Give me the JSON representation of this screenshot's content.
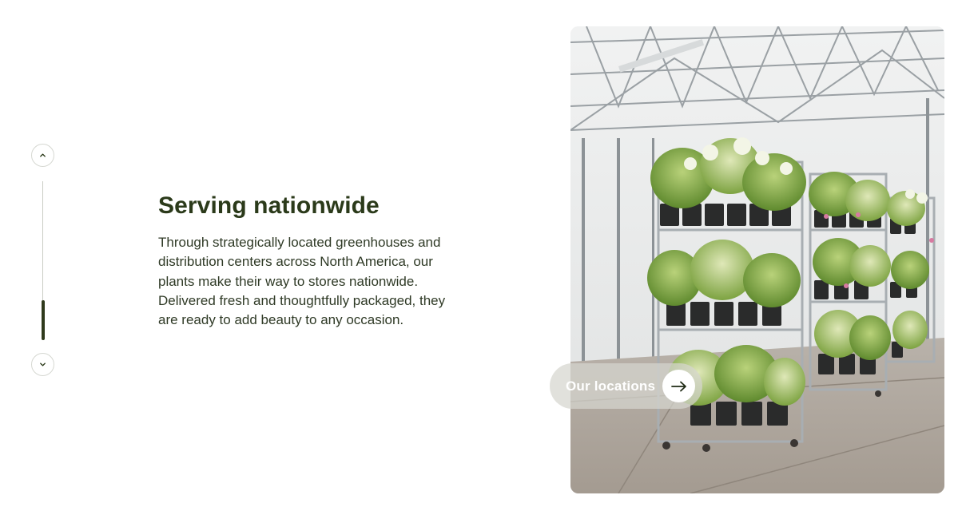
{
  "slider": {
    "up_icon": "chevron-up-icon",
    "down_icon": "chevron-down-icon",
    "progress": 0.25
  },
  "section": {
    "title": "Serving nationwide",
    "body": "Through strategically located greenhouses and distribution centers across North America, our plants make their way to stores nationwide. Delivered fresh and thoughtfully packaged, they are ready to add beauty to any occasion."
  },
  "image": {
    "alt": "Greenhouse carts filled with potted hydrangeas",
    "icon": "greenhouse-photo"
  },
  "cta": {
    "label": "Our locations",
    "icon": "arrow-right-icon"
  },
  "colors": {
    "heading": "#2b3a1a",
    "body_text": "#2f3a26",
    "accent": "#2f3a1c",
    "track": "#c9ccc4"
  }
}
